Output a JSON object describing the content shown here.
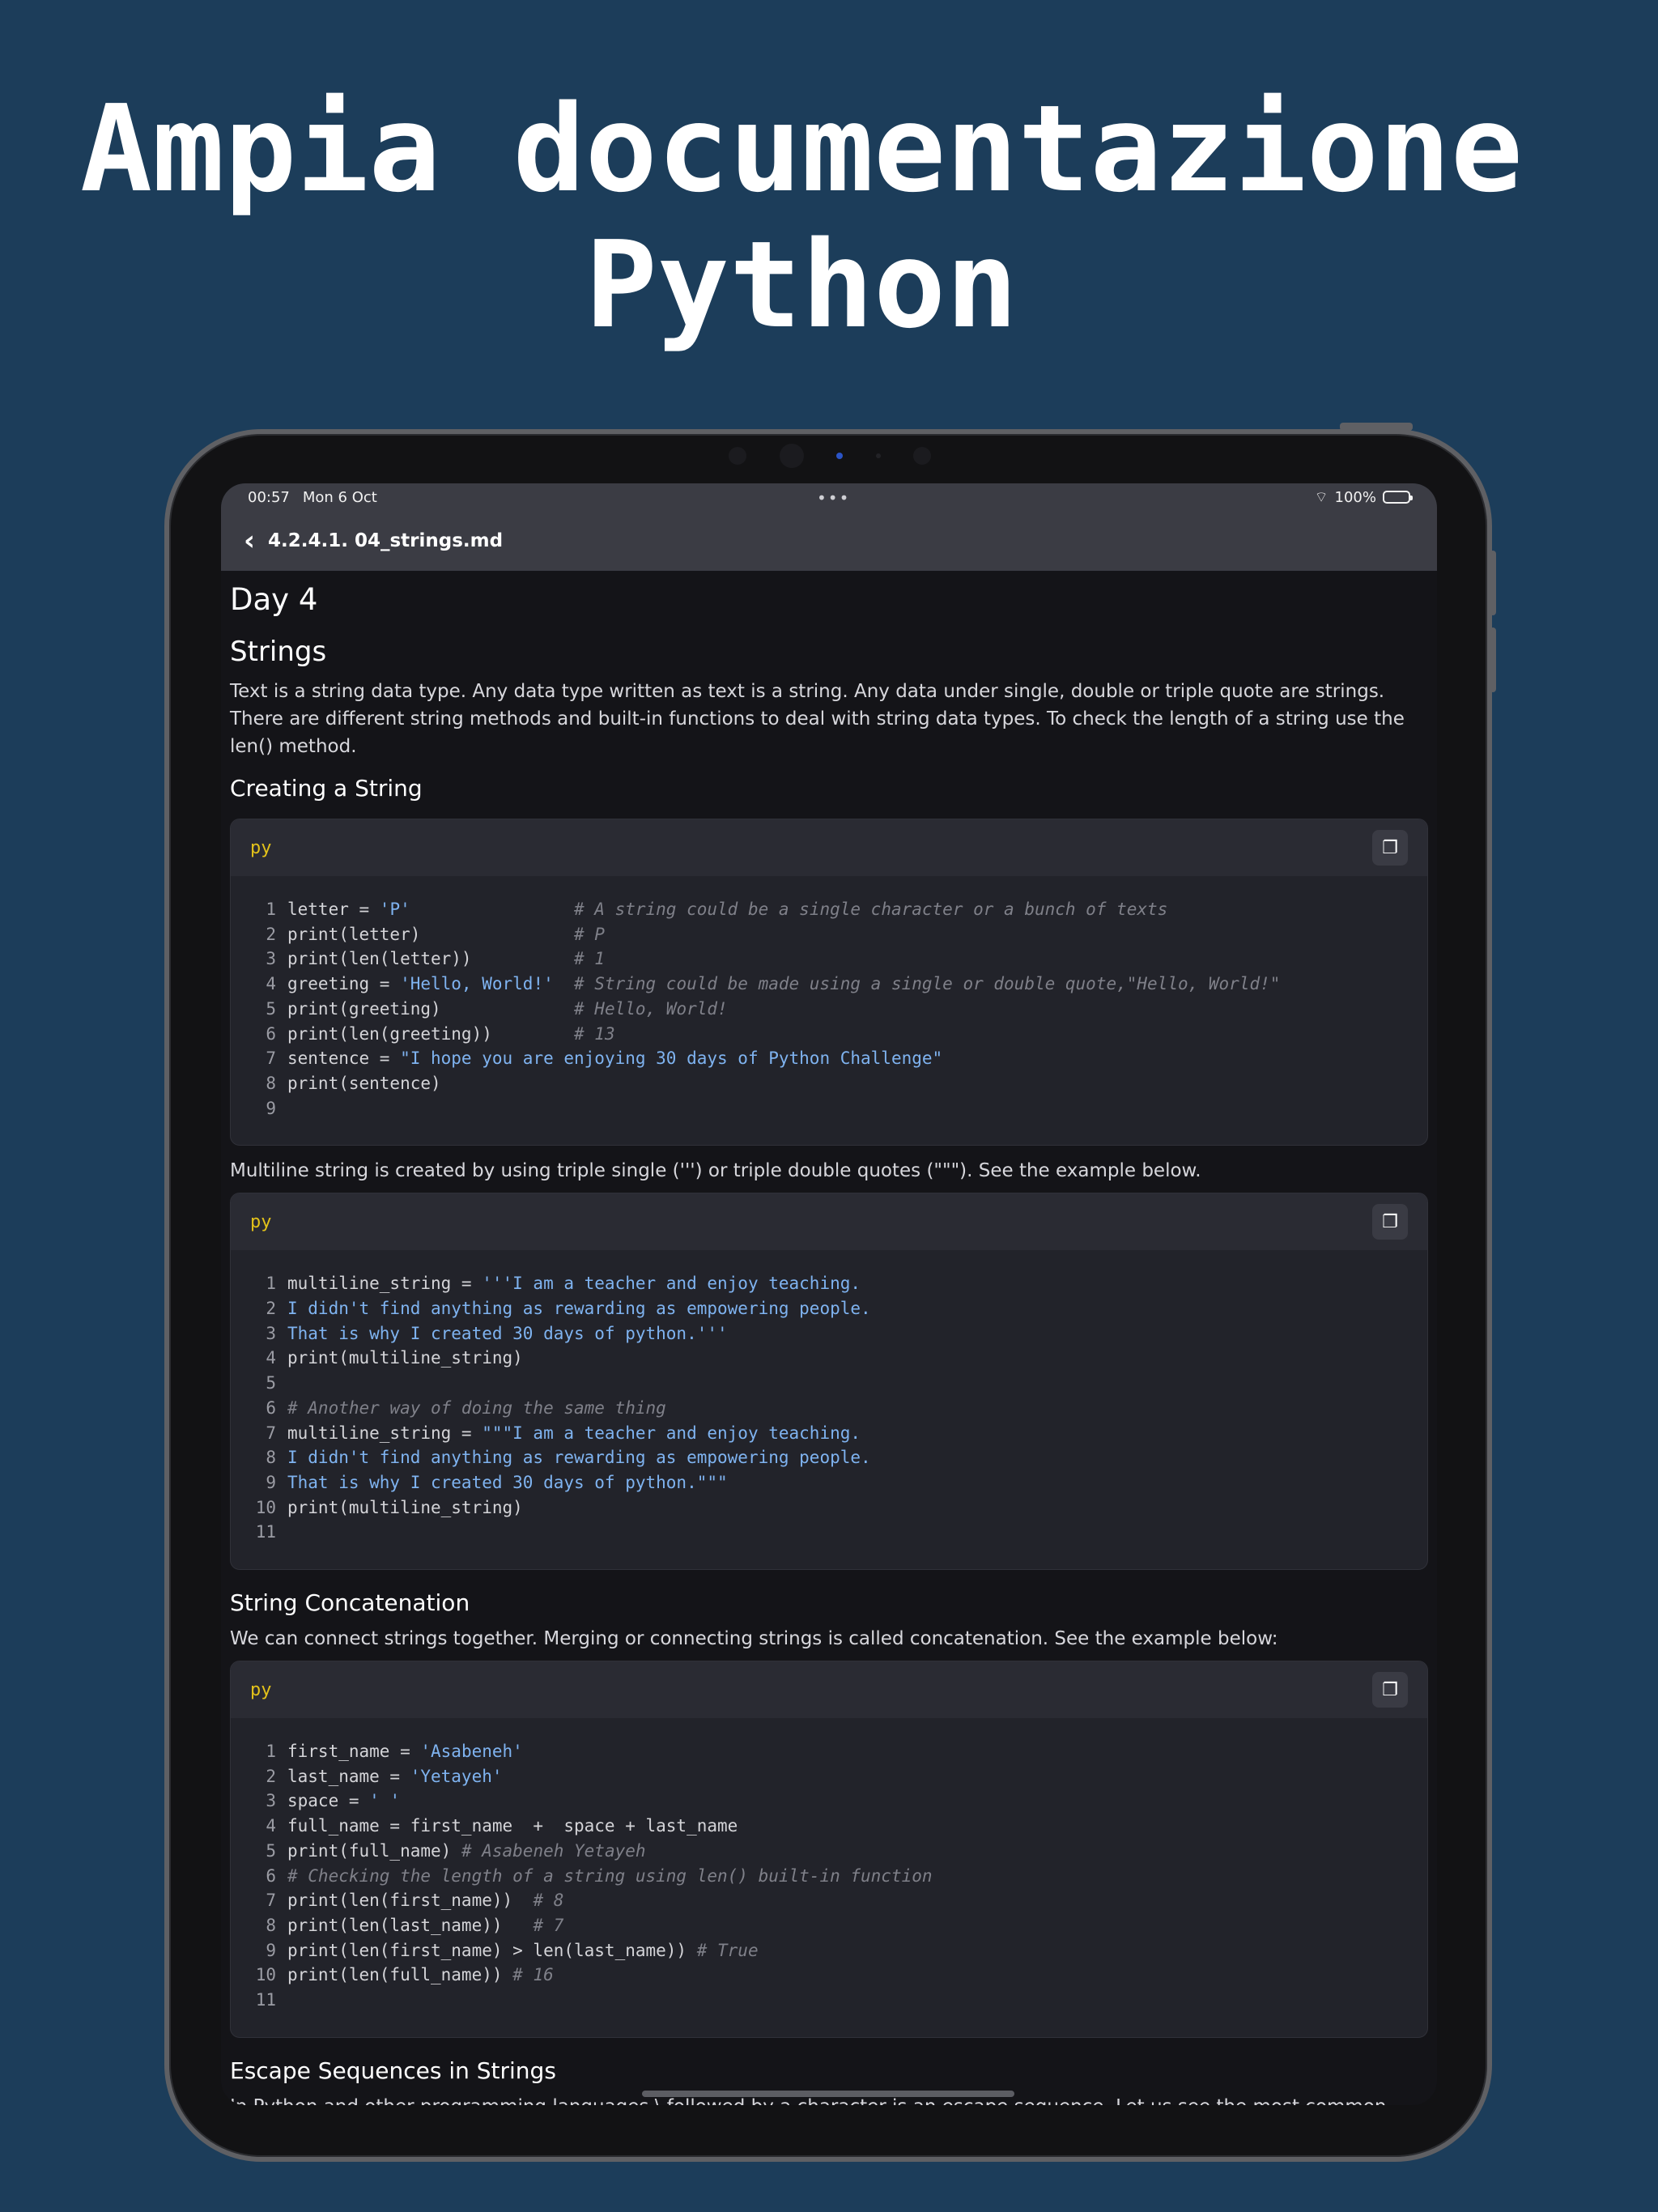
{
  "headline": {
    "line1": "Ampia documentazione",
    "line2": "Python"
  },
  "status": {
    "time": "00:57",
    "date": "Mon 6 Oct",
    "dots": "•••",
    "battery": "100%"
  },
  "nav": {
    "title": "4.2.4.1. 04_strings.md"
  },
  "doc": {
    "day": "Day 4",
    "strings_heading": "Strings",
    "strings_intro": "Text is a string data type. Any data type written as text is a string. Any data under single, double or triple quote are strings. There are different string methods and built-in functions to deal with string data types. To check the length of a string use the len() method.",
    "creating_heading": "Creating a String",
    "multiline_intro": "Multiline string is created by using triple single (''') or triple double quotes (\"\"\"). See the example below.",
    "concat_heading": "String Concatenation",
    "concat_intro": "We can connect strings together. Merging or connecting strings is called concatenation. See the example below:",
    "escape_heading": "Escape Sequences in Strings",
    "escape_intro": "In Python and other programming languages \\ followed by a character is an escape sequence. Let us see the most common escape characters:"
  },
  "code_blocks": [
    {
      "lang": "py",
      "lines": [
        [
          [
            "letter = ",
            "p"
          ],
          [
            "'P'",
            "s"
          ],
          [
            "                # A string could be a single character or a bunch of texts",
            "c"
          ]
        ],
        [
          [
            "print(letter)               ",
            "p"
          ],
          [
            "# P",
            "c"
          ]
        ],
        [
          [
            "print(len(letter))          ",
            "p"
          ],
          [
            "# 1",
            "c"
          ]
        ],
        [
          [
            "greeting = ",
            "p"
          ],
          [
            "'Hello, World!'",
            "s"
          ],
          [
            "  # String could be made using a single or double quote,\"Hello, World!\"",
            "c"
          ]
        ],
        [
          [
            "print(greeting)             ",
            "p"
          ],
          [
            "# Hello, World!",
            "c"
          ]
        ],
        [
          [
            "print(len(greeting))        ",
            "p"
          ],
          [
            "# 13",
            "c"
          ]
        ],
        [
          [
            "sentence = ",
            "p"
          ],
          [
            "\"I hope you are enjoying 30 days of Python Challenge\"",
            "s"
          ]
        ],
        [
          [
            "print(sentence)",
            "p"
          ]
        ],
        []
      ]
    },
    {
      "lang": "py",
      "lines": [
        [
          [
            "multiline_string = ",
            "p"
          ],
          [
            "'''I am a teacher and enjoy teaching.",
            "s"
          ]
        ],
        [
          [
            "I didn't find anything as rewarding as empowering people.",
            "s"
          ]
        ],
        [
          [
            "That is why I created 30 days of python.'''",
            "s"
          ]
        ],
        [
          [
            "print(multiline_string)",
            "p"
          ]
        ],
        [],
        [
          [
            "# Another way of doing the same thing",
            "c"
          ]
        ],
        [
          [
            "multiline_string = ",
            "p"
          ],
          [
            "\"\"\"I am a teacher and enjoy teaching.",
            "s"
          ]
        ],
        [
          [
            "I didn't find anything as rewarding as empowering people.",
            "s"
          ]
        ],
        [
          [
            "That is why I created 30 days of python.\"\"\"",
            "s"
          ]
        ],
        [
          [
            "print(multiline_string)",
            "p"
          ]
        ],
        []
      ]
    },
    {
      "lang": "py",
      "lines": [
        [
          [
            "first_name = ",
            "p"
          ],
          [
            "'Asabeneh'",
            "s"
          ]
        ],
        [
          [
            "last_name = ",
            "p"
          ],
          [
            "'Yetayeh'",
            "s"
          ]
        ],
        [
          [
            "space = ",
            "p"
          ],
          [
            "' '",
            "s"
          ]
        ],
        [
          [
            "full_name = first_name  +  space + last_name",
            "p"
          ]
        ],
        [
          [
            "print(full_name) ",
            "p"
          ],
          [
            "# Asabeneh Yetayeh",
            "c"
          ]
        ],
        [
          [
            "# Checking the length of a string using len() built-in function",
            "c"
          ]
        ],
        [
          [
            "print(len(first_name))  ",
            "p"
          ],
          [
            "# 8",
            "c"
          ]
        ],
        [
          [
            "print(len(last_name))   ",
            "p"
          ],
          [
            "# 7",
            "c"
          ]
        ],
        [
          [
            "print(len(first_name) > len(last_name)) ",
            "p"
          ],
          [
            "# True",
            "c"
          ]
        ],
        [
          [
            "print(len(full_name)) ",
            "p"
          ],
          [
            "# 16",
            "c"
          ]
        ],
        []
      ]
    }
  ],
  "icons": {
    "back": "chevron-left-icon",
    "copy": "copy-icon",
    "wifi": "wifi-icon",
    "battery": "battery-icon"
  },
  "colors": {
    "background": "#1c3d5a",
    "screen": "#141418",
    "navbar": "#3b3c44",
    "code_bg": "#22232a",
    "lang_label": "#e3c21a",
    "string_literal": "#7fb3f0",
    "comment": "#7f8089"
  }
}
